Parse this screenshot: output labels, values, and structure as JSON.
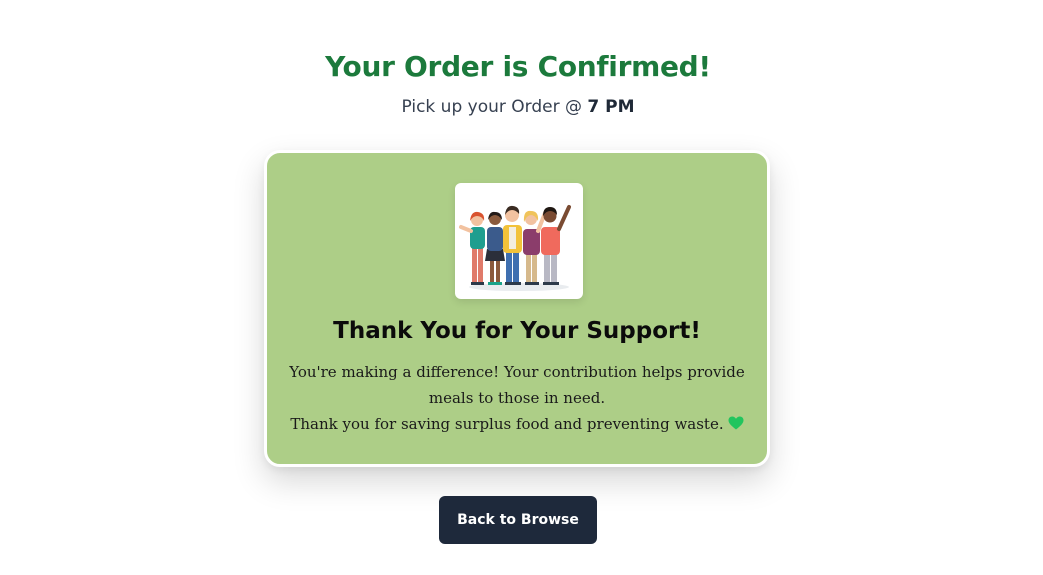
{
  "header": {
    "title": "Your Order is Confirmed!",
    "pickup_prefix": "Pick up your Order @",
    "pickup_time": "7 PM",
    "title_color": "#1c7a3c"
  },
  "card": {
    "background_color": "#adce87",
    "illustration_icon": "group-of-people-celebrating-icon",
    "heading": "Thank You for Your Support!",
    "message_line1": "You're making a difference! Your contribution helps provide meals to those in need.",
    "message_line2": "Thank you for saving surplus food and preventing waste.",
    "heart_icon": "green-heart-icon",
    "heart_color": "#22c55e"
  },
  "actions": {
    "back_label": "Back to Browse",
    "button_color": "#1e293b"
  }
}
